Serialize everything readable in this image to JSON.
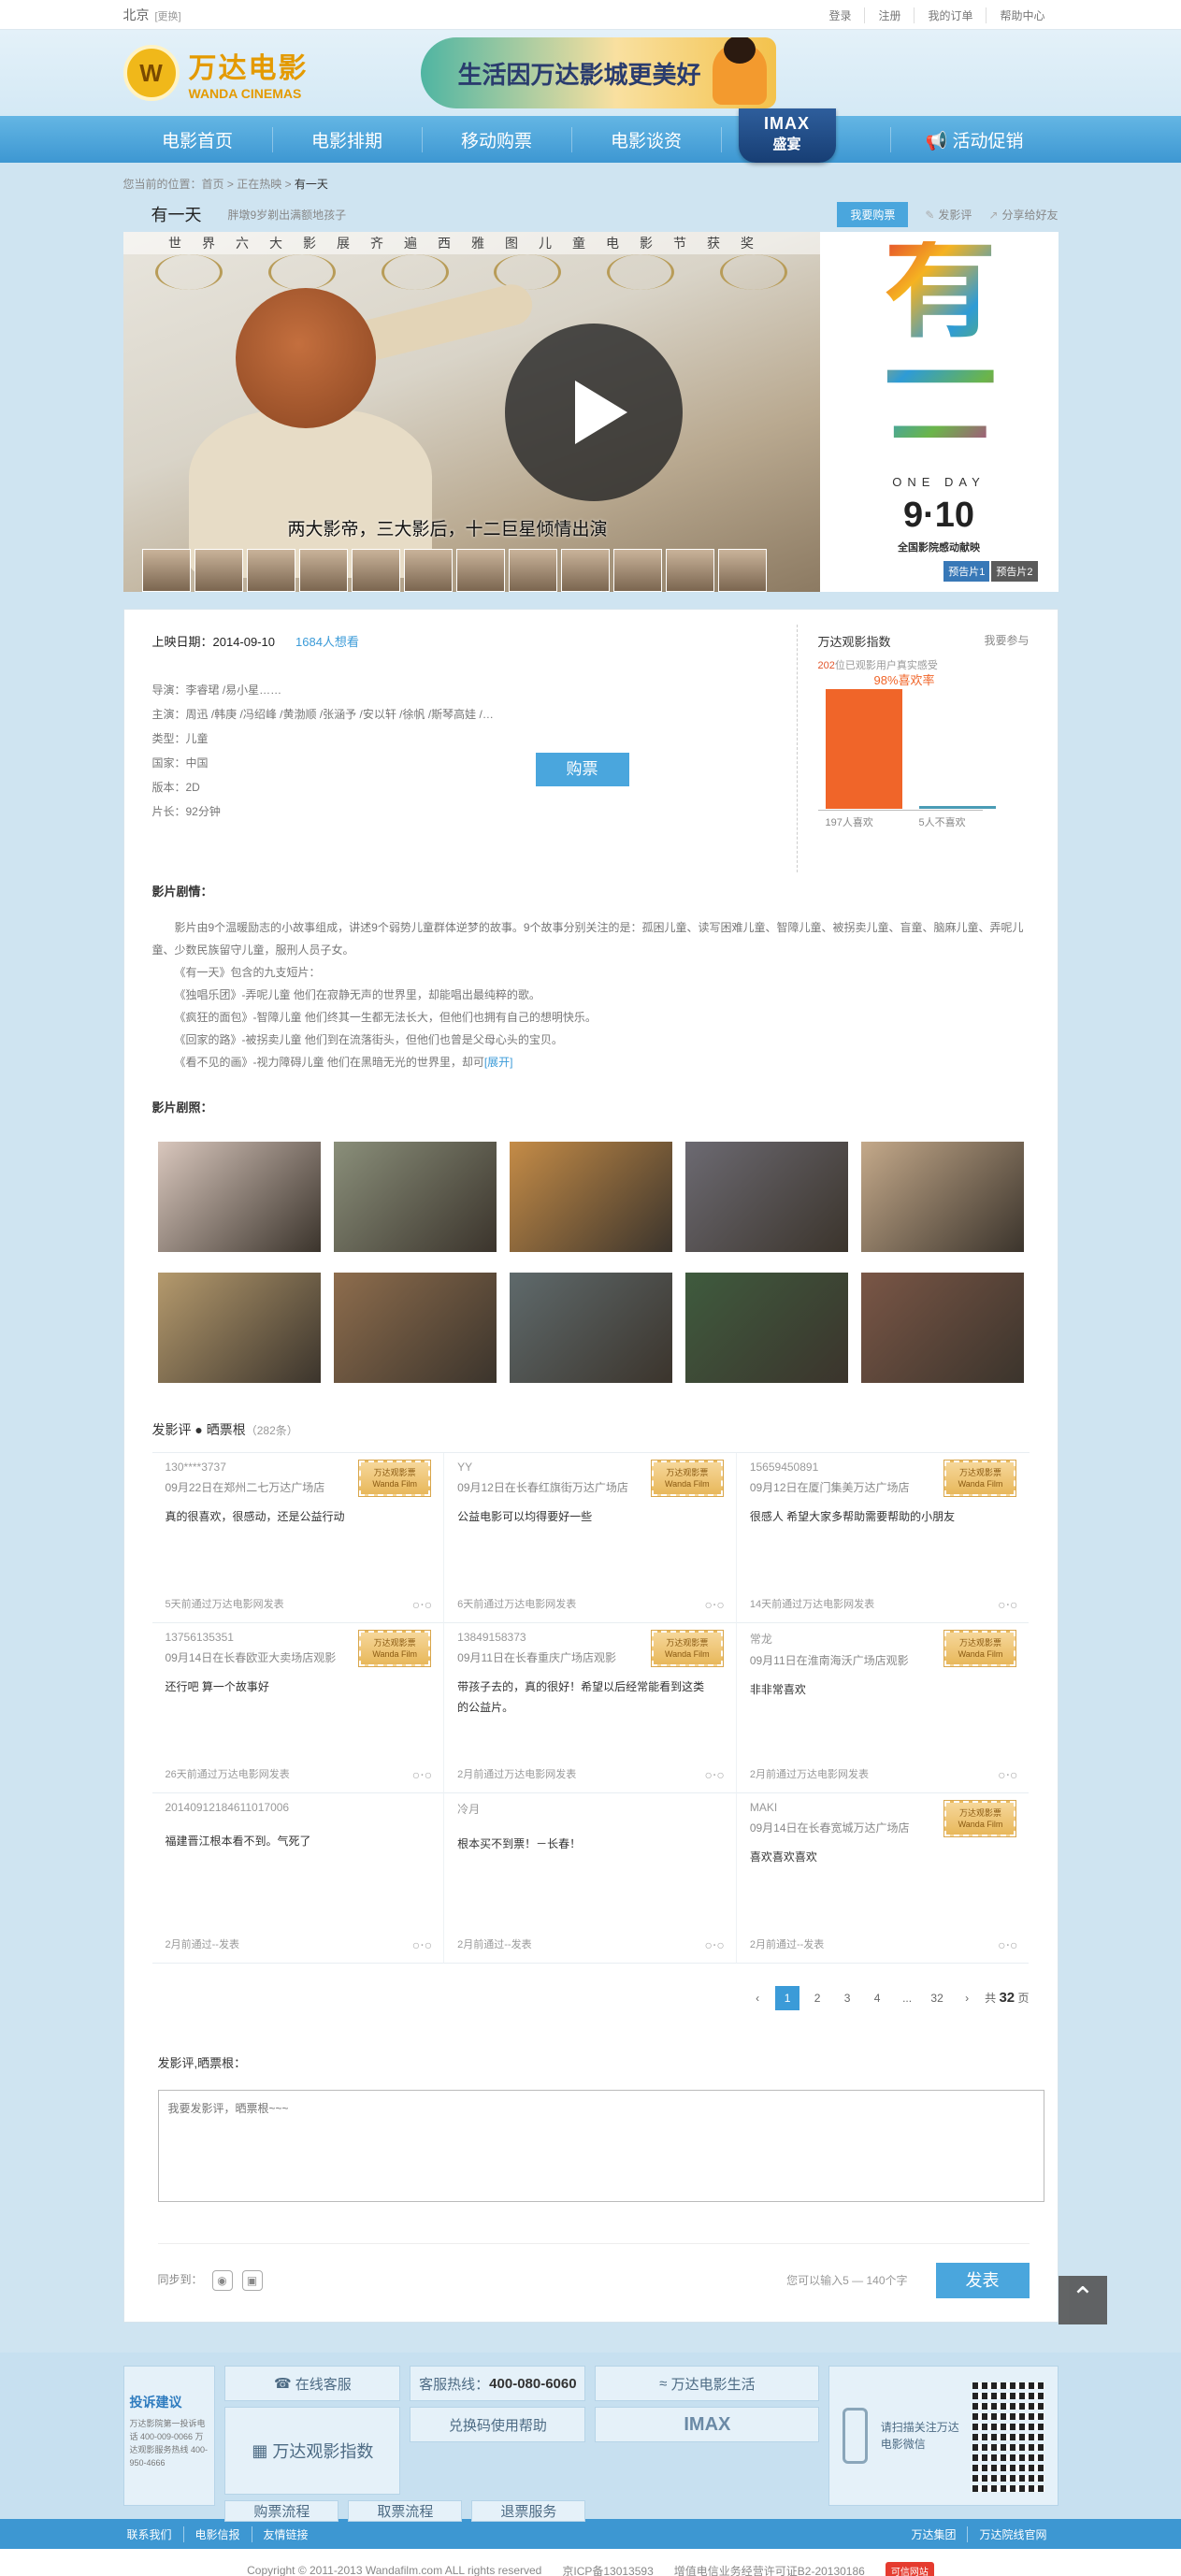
{
  "topbar": {
    "city": "北京",
    "switch": "[更换]",
    "links": [
      "登录",
      "注册",
      "我的订单",
      "帮助中心"
    ]
  },
  "header": {
    "brand_cn": "万达电影",
    "brand_en": "WANDA CINEMAS",
    "banner": "生活因万达影城更美好"
  },
  "nav": {
    "items": [
      "电影首页",
      "电影排期",
      "移动购票",
      "电影谈资"
    ],
    "imax_top": "IMAX",
    "imax_bottom": "盛宴",
    "promo": "活动促销"
  },
  "crumb": {
    "prefix": "您当前的位置：",
    "home": "首页",
    "section": "正在热映",
    "current": "有一天"
  },
  "movie": {
    "title": "有一天",
    "subtitle": "胖墩9岁剃出满额地孩子",
    "buy_small": "我要购票",
    "review_link": "发影评",
    "share_link": "分享给好友",
    "awards": "世界六大影展齐遍西雅图儿童电影节获奖",
    "tagline": "两大影帝，三大影后，十二巨星倾情出演",
    "poster_title": "有一天",
    "poster_en": "ONE DAY",
    "poster_date": "9·10",
    "poster_note": "全国影院感动献映",
    "trailer1": "预告片1",
    "trailer2": "预告片2"
  },
  "info": {
    "release_label": "上映日期：",
    "release_date": "2014-09-10",
    "want": "1684人想看",
    "director": "导演：李睿珺 /易小星……",
    "cast": "主演：周迅 /韩庚 /冯绍峰 /黄渤顺 /张涵予 /安以轩 /徐帆 /斯琴高娃 /…",
    "genre": "类型：儿童",
    "country": "国家：中国",
    "version": "版本：2D",
    "length": "片长：92分钟",
    "buy": "购票"
  },
  "index": {
    "title": "万达观影指数",
    "join": "我要参与",
    "sub_count": "202",
    "sub_text": "位已观影用户真实感受",
    "good_pct": "98%喜欢率",
    "good_label": "197人喜欢",
    "bad_label": "5人不喜欢"
  },
  "chart_data": {
    "type": "bar",
    "categories": [
      "197人喜欢",
      "5人不喜欢"
    ],
    "values": [
      197,
      5
    ],
    "title": "",
    "xlabel": "",
    "ylabel": "",
    "ylim": [
      0,
      197
    ],
    "bar_colors": [
      "#f06529",
      "#4a9cb5"
    ]
  },
  "plot": {
    "title": "影片剧情：",
    "lines": [
      "影片由9个温暖励志的小故事组成，讲述9个弱势儿童群体逆梦的故事。9个故事分别关注的是：孤困儿童、读写困难儿童、智障儿童、被拐卖儿童、盲童、脑麻儿童、弄呢儿童、少数民族留守儿童，服刑人员子女。",
      "《有一天》包含的九支短片：",
      "《独唱乐团》-弄呢儿童 他们在寂静无声的世界里，却能唱出最纯粹的歌。",
      "《疯狂的面包》-智障儿童 他们终其一生都无法长大，但他们也拥有自己的想明快乐。",
      "《回家的路》-被拐卖儿童 他们到在流落街头，但他们也曾是父母心头的宝贝。",
      "《看不见的画》-视力障碍儿童 他们在黑暗无光的世界里，却可"
    ],
    "more": "[展开]"
  },
  "stills": {
    "title": "影片剧照：",
    "colors": [
      "#d9c7bd",
      "#8a8f7a",
      "#c58c47",
      "#6c6a72",
      "#c4a98a",
      "#b59a6d",
      "#8e6d4d",
      "#5f6a6c",
      "#3f5b3e",
      "#7a5646"
    ]
  },
  "reviews": {
    "title": "发影评 ● 晒票根",
    "count": "（282条）",
    "stub": "万达观影票 Wanda Film",
    "items": [
      {
        "user": "130****3737",
        "place": "09月22日在郑州二七万达广场店",
        "text": "真的很喜欢，很感动，还是公益行动",
        "foot": "5天前通过万达电影网发表",
        "stub": true
      },
      {
        "user": "YY",
        "place": "09月12日在长春红旗街万达广场店",
        "text": "公益电影可以均得要好一些",
        "foot": "6天前通过万达电影网发表",
        "stub": true
      },
      {
        "user": "15659450891",
        "place": "09月12日在厦门集美万达广场店",
        "text": "很感人 希望大家多帮助需要帮助的小朋友",
        "foot": "14天前通过万达电影网发表",
        "stub": true
      },
      {
        "user": "13756135351",
        "place": "09月14日在长春欧亚大卖场店观影",
        "text": "还行吧 算一个故事好",
        "foot": "26天前通过万达电影网发表",
        "stub": true
      },
      {
        "user": "13849158373",
        "place": "09月11日在长春重庆广场店观影",
        "text": "带孩子去的，真的很好！希望以后经常能看到这类的公益片。",
        "foot": "2月前通过万达电影网发表",
        "stub": true
      },
      {
        "user": "常龙",
        "place": "09月11日在淮南海沃广场店观影",
        "text": "非非常喜欢",
        "foot": "2月前通过万达电影网发表",
        "stub": true
      },
      {
        "user": "20140912184611017006",
        "place": "",
        "text": "福建晋江根本看不到。气死了",
        "foot": "2月前通过--发表",
        "stub": false
      },
      {
        "user": "冷月",
        "place": "",
        "text": "根本买不到票！－长春！",
        "foot": "2月前通过--发表",
        "stub": false
      },
      {
        "user": "MAKI",
        "place": "09月14日在长春宽城万达广场店",
        "text": "喜欢喜欢喜欢",
        "foot": "2月前通过--发表",
        "stub": true
      }
    ]
  },
  "pager": {
    "prev": "‹",
    "pages": [
      "1",
      "2",
      "3",
      "4",
      "...",
      "32"
    ],
    "next": "›",
    "total_prefix": "共",
    "total": "32",
    "total_suffix": "页"
  },
  "comment": {
    "title": "发影评,晒票根：",
    "placeholder": "我要发影评，晒票根~~~",
    "sync": "同步到：",
    "limit": "您可以输入5 — 140个字",
    "submit": "发表"
  },
  "footer": {
    "advice_title": "投诉建议",
    "advice_text": "万达影院第一投诉电话 400-009-0066 万达观影服务热线 400-950-4666",
    "online": "在线客服",
    "hotline_label": "客服热线：",
    "hotline": "400-080-6060",
    "life": "万达电影生活",
    "redeem": "兑换码使用帮助",
    "imax": "IMAX",
    "index": "万达观影指数",
    "flow1": "购票流程",
    "flow2": "取票流程",
    "flow3": "退票服务",
    "qr_text": "请扫描关注万达电影微信",
    "nav_left": [
      "联系我们",
      "电影信报",
      "友情链接"
    ],
    "nav_right": [
      "万达集团",
      "万达院线官网"
    ],
    "copyright": "Copyright © 2011-2013 Wandafilm.com ALL rights reserved",
    "icp": "京ICP备13013593",
    "license": "增值电信业务经营许可证B2-20130186",
    "badge": "可信网站"
  }
}
